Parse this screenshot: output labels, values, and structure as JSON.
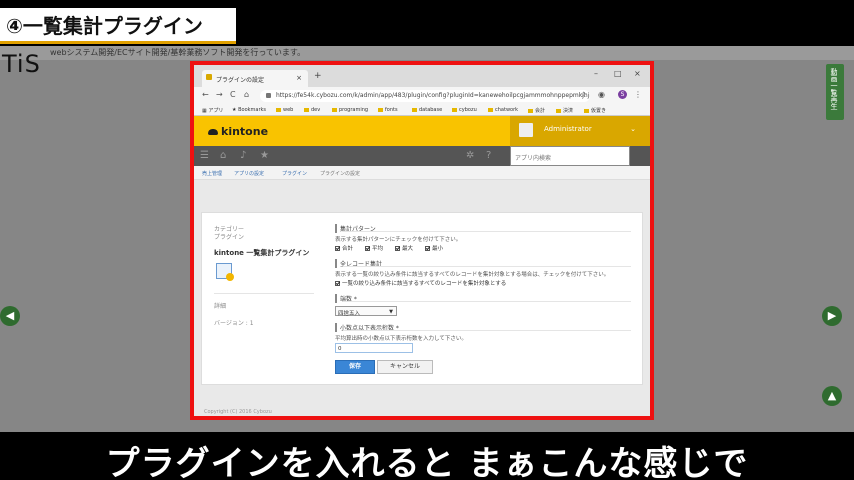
{
  "video": {
    "section_title": "④一覧集計プラグイン",
    "sub_text": "webシステム開発/ECサイト開発/基幹業務ソフト開発を行っています。",
    "channel_logo": "TiS",
    "side_tab": "動画一覧再生",
    "caption": "プラグインを入れると まぁこんな感じで",
    "nav_prev": "◀",
    "nav_next": "▶",
    "nav_up": "▲"
  },
  "browser": {
    "tab_title": "プラグインの設定",
    "tab_close": "×",
    "new_tab": "+",
    "win_min": "–",
    "win_max": "□",
    "win_close": "×",
    "back": "←",
    "forward": "→",
    "reload": "C",
    "home": "⌂",
    "url": "https://fe54k.cybozu.com/k/admin/app/483/plugin/config?pluginId=kanewehoilpcgjammmohnppepmkjhjbn",
    "bookmarks": [
      "アプリ",
      "Bookmarks",
      "web",
      "dev",
      "programing",
      "fonts",
      "database",
      "cybozu",
      "chatwork",
      "会計",
      "決済",
      "仮置き"
    ]
  },
  "kintone": {
    "logo": "kintone",
    "user": "Administrator",
    "user_caret": "⌄",
    "search_placeholder": "アプリ内検索",
    "breadcrumb": [
      "売上管理",
      "アプリの設定",
      "プラグイン",
      "プラグインの設定"
    ],
    "footer": "Copyright (C) 2016 Cybozu"
  },
  "plugin": {
    "category_label": "カテゴリー",
    "category_value": "プラグイン",
    "name": "kintone 一覧集計プラグイン",
    "details_label": "詳細",
    "version": "バージョン : 1",
    "pattern_title": "集計パターン",
    "pattern_desc": "表示する集計パターンにチェックを付けて下さい。",
    "patterns": [
      "合計",
      "平均",
      "最大",
      "最小"
    ],
    "all_records_title": "全レコード集計",
    "all_records_desc": "表示する一覧の絞り込み条件に該当するすべてのレコードを集計対象とする場合は、チェックを付けて下さい。",
    "all_records_check": "一覧の絞り込み条件に該当するすべてのレコードを集計対象とする",
    "rounding_title": "端数 *",
    "rounding_value": "四捨五入",
    "decimal_title": "小数点以下表示桁数 *",
    "decimal_desc": "平均算出時の小数点以下表示桁数を入力して下さい。",
    "decimal_value": "0",
    "save_label": "保存",
    "cancel_label": "キャンセル"
  },
  "colors": {
    "frame_border": "#ee1111",
    "kintone_yellow": "#f9c300",
    "save_blue": "#3a86d6"
  }
}
